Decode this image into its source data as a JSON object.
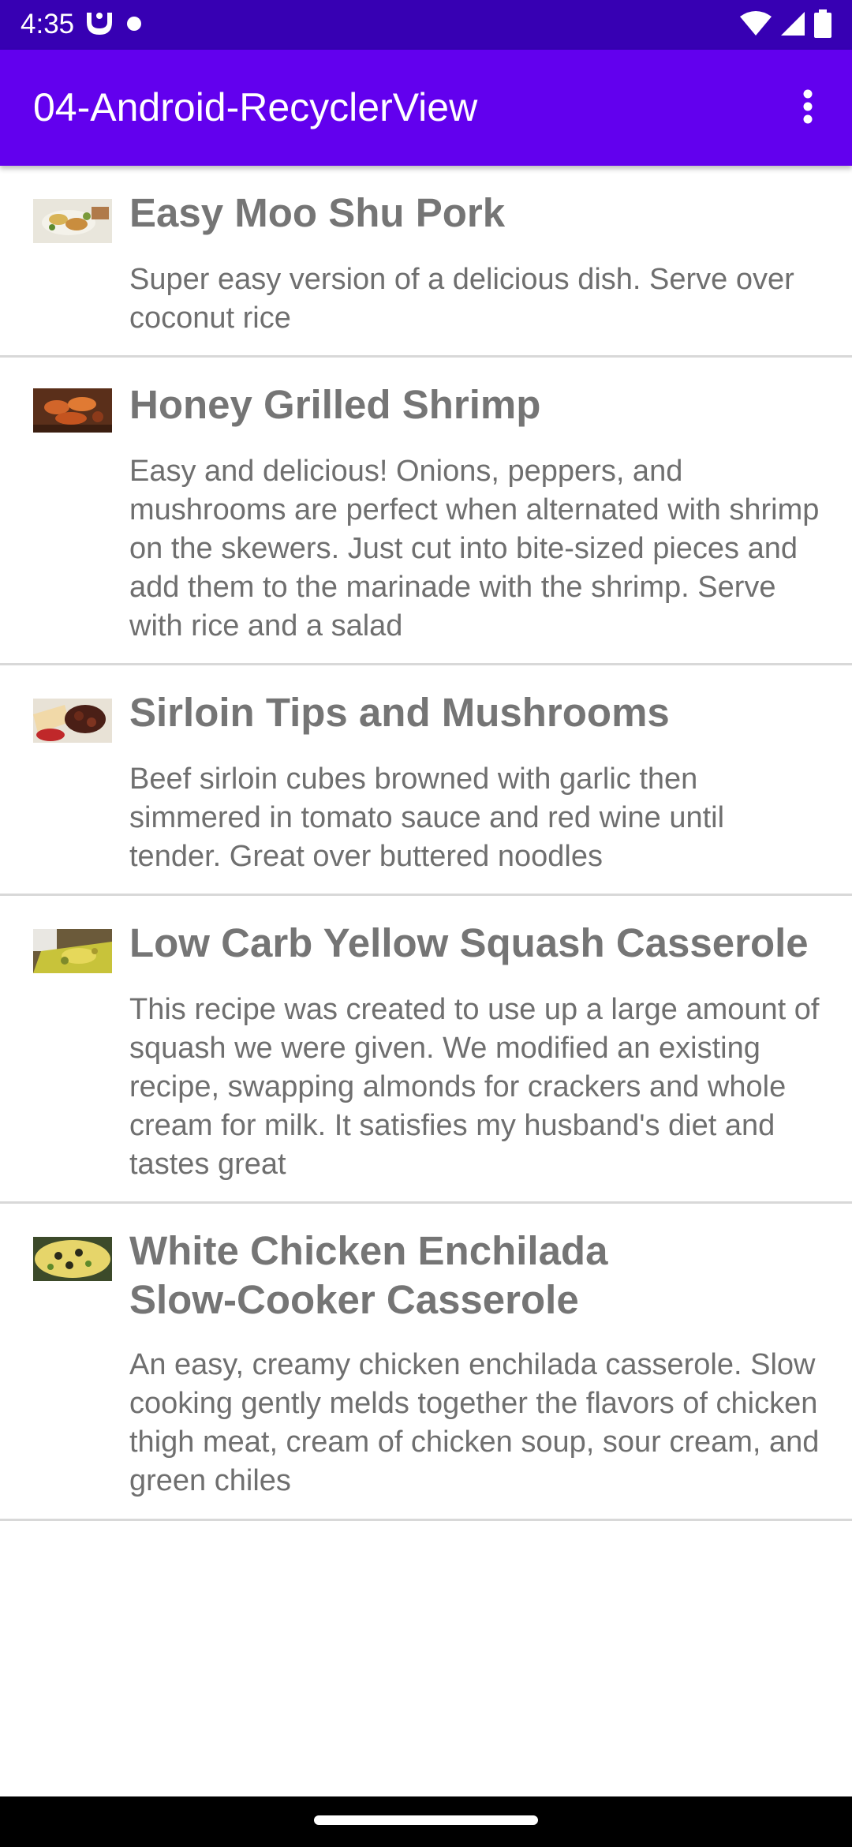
{
  "status_bar": {
    "time": "4:35",
    "icons": [
      "notification-app-icon",
      "dot-icon",
      "wifi-icon",
      "signal-icon",
      "battery-icon"
    ]
  },
  "app_bar": {
    "title": "04-Android-RecyclerView",
    "overflow_icon": "more-vert-icon"
  },
  "recipes": [
    {
      "title": "Easy Moo Shu Pork",
      "description": "Super easy version of a delicious dish. Serve over coconut rice"
    },
    {
      "title": "Honey Grilled Shrimp",
      "description": "Easy and delicious! Onions, peppers, and mushrooms are perfect when alternated with shrimp on the skewers. Just cut into bite-sized pieces and add them to the marinade with the shrimp. Serve with rice and a salad"
    },
    {
      "title": "Sirloin Tips and Mushrooms",
      "description": "Beef sirloin cubes browned with garlic then simmered in tomato sauce and red wine until tender. Great over buttered noodles"
    },
    {
      "title": "Low Carb Yellow Squash Casserole",
      "description": "This recipe was created to use up a large amount of squash we were given. We modified an existing recipe, swapping almonds for crackers and whole cream for milk. It satisfies my husband's diet and tastes great"
    },
    {
      "title": "White Chicken Enchilada Slow-Cooker Casserole",
      "description": "An easy, creamy chicken enchilada casserole. Slow cooking gently melds together the flavors of chicken thigh meat, cream of chicken soup, sour cream, and green chiles"
    }
  ],
  "colors": {
    "status_bar": "#3700b3",
    "app_bar": "#6200ee",
    "title_text": "#757575",
    "body_text": "#6f6f6f",
    "divider": "#d8d8d8"
  }
}
